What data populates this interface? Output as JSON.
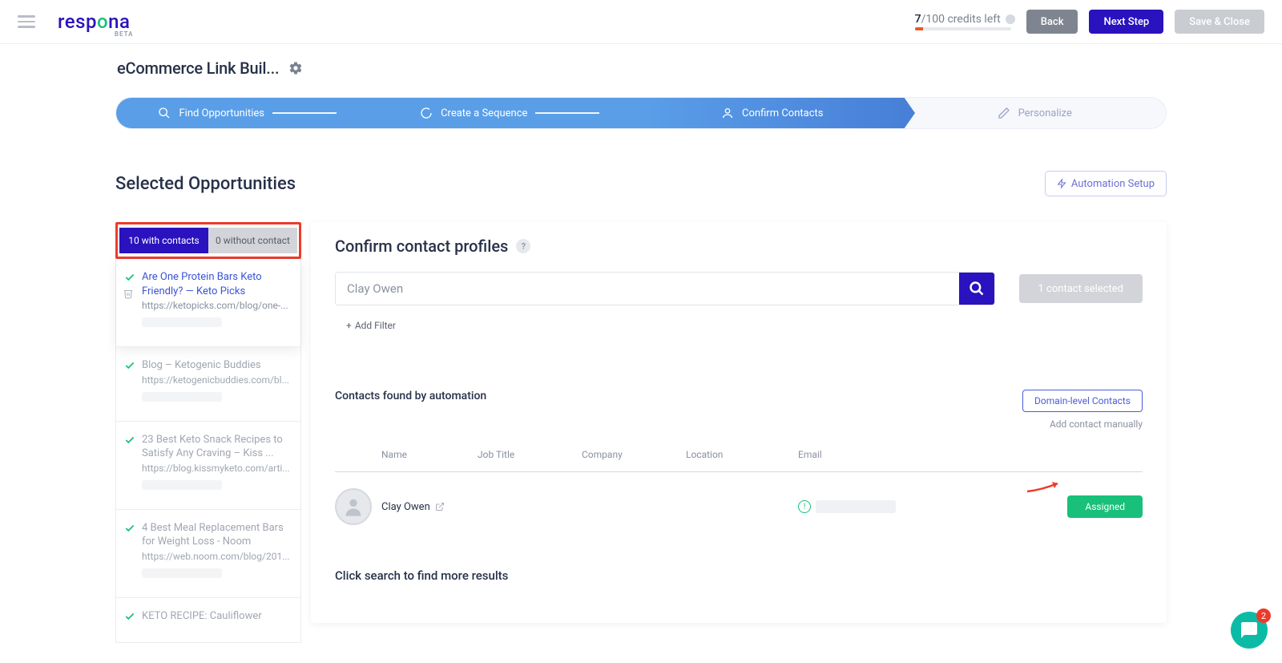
{
  "header": {
    "credits_used": "7",
    "credits_total": "/100",
    "credits_label": "credits left",
    "back": "Back",
    "next": "Next Step",
    "save": "Save & Close"
  },
  "campaign": {
    "title": "eCommerce Link Buil..."
  },
  "stepper": {
    "step1": "Find Opportunities",
    "step2": "Create a Sequence",
    "step3": "Confirm Contacts",
    "step4": "Personalize"
  },
  "section": {
    "title": "Selected Opportunities",
    "automation": "Automation Setup"
  },
  "tabs": {
    "with": "10 with contacts",
    "without": "0 without contact"
  },
  "opps": [
    {
      "title": "Are One Protein Bars Keto Friendly? — Keto Picks",
      "url": "https://ketopicks.com/blog/one-..."
    },
    {
      "title": "Blog – Ketogenic Buddies",
      "url": "https://ketogenicbuddies.com/bl..."
    },
    {
      "title": "23 Best Keto Snack Recipes to Satisfy Any Craving – Kiss ...",
      "url": "https://blog.kissmyketo.com/arti..."
    },
    {
      "title": "4 Best Meal Replacement Bars for Weight Loss - Noom",
      "url": "https://web.noom.com/blog/201..."
    },
    {
      "title": "KETO RECIPE: Cauliflower",
      "url": ""
    }
  ],
  "panel": {
    "heading": "Confirm contact profiles",
    "search_value": "Clay Owen",
    "selected_pill": "1 contact selected",
    "add_filter": "Add Filter",
    "contacts_heading": "Contacts found by automation",
    "domain_btn": "Domain-level Contacts",
    "manual_link": "Add contact manually",
    "columns": {
      "name": "Name",
      "job": "Job Title",
      "company": "Company",
      "location": "Location",
      "email": "Email"
    },
    "contact": {
      "name": "Clay Owen",
      "status": "Assigned"
    },
    "search_hint": "Click search to find more results"
  },
  "chat": {
    "badge": "2"
  }
}
